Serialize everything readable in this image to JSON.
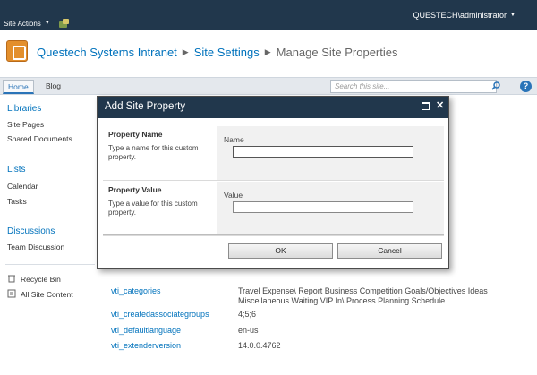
{
  "ribbon": {
    "site_actions_label": "Site Actions",
    "user_label": "QUESTECH\\administrator"
  },
  "breadcrumb": {
    "site": "Questech Systems Intranet",
    "section": "Site Settings",
    "current": "Manage Site Properties"
  },
  "topnav": {
    "tabs": [
      {
        "label": "Home"
      },
      {
        "label": "Blog"
      }
    ],
    "search_placeholder": "Search this site..."
  },
  "leftnav": {
    "libraries_heading": "Libraries",
    "libraries": [
      "Site Pages",
      "Shared Documents"
    ],
    "lists_heading": "Lists",
    "lists": [
      "Calendar",
      "Tasks"
    ],
    "discussions_heading": "Discussions",
    "discussions": [
      "Team Discussion"
    ],
    "recycle_bin": "Recycle Bin",
    "all_content": "All Site Content"
  },
  "properties": [
    {
      "key": "vti_categories",
      "value": "Travel Expense\\ Report Business Competition Goals/Objectives Ideas Miscellaneous Waiting VIP In\\ Process Planning Schedule"
    },
    {
      "key": "vti_createdassociategroups",
      "value": "4;5;6"
    },
    {
      "key": "vti_defaultlanguage",
      "value": "en-us"
    },
    {
      "key": "vti_extenderversion",
      "value": "14.0.0.4762"
    }
  ],
  "dialog": {
    "title": "Add Site Property",
    "name_section": {
      "title": "Property Name",
      "description": "Type a name for this custom property.",
      "field_label": "Name",
      "value": ""
    },
    "value_section": {
      "title": "Property Value",
      "description": "Type a value for this custom property.",
      "field_label": "Value",
      "value": ""
    },
    "ok_label": "OK",
    "cancel_label": "Cancel"
  },
  "colors": {
    "ribbon": "#21374c",
    "link": "#0072bc",
    "logo": "#e38f2c"
  }
}
